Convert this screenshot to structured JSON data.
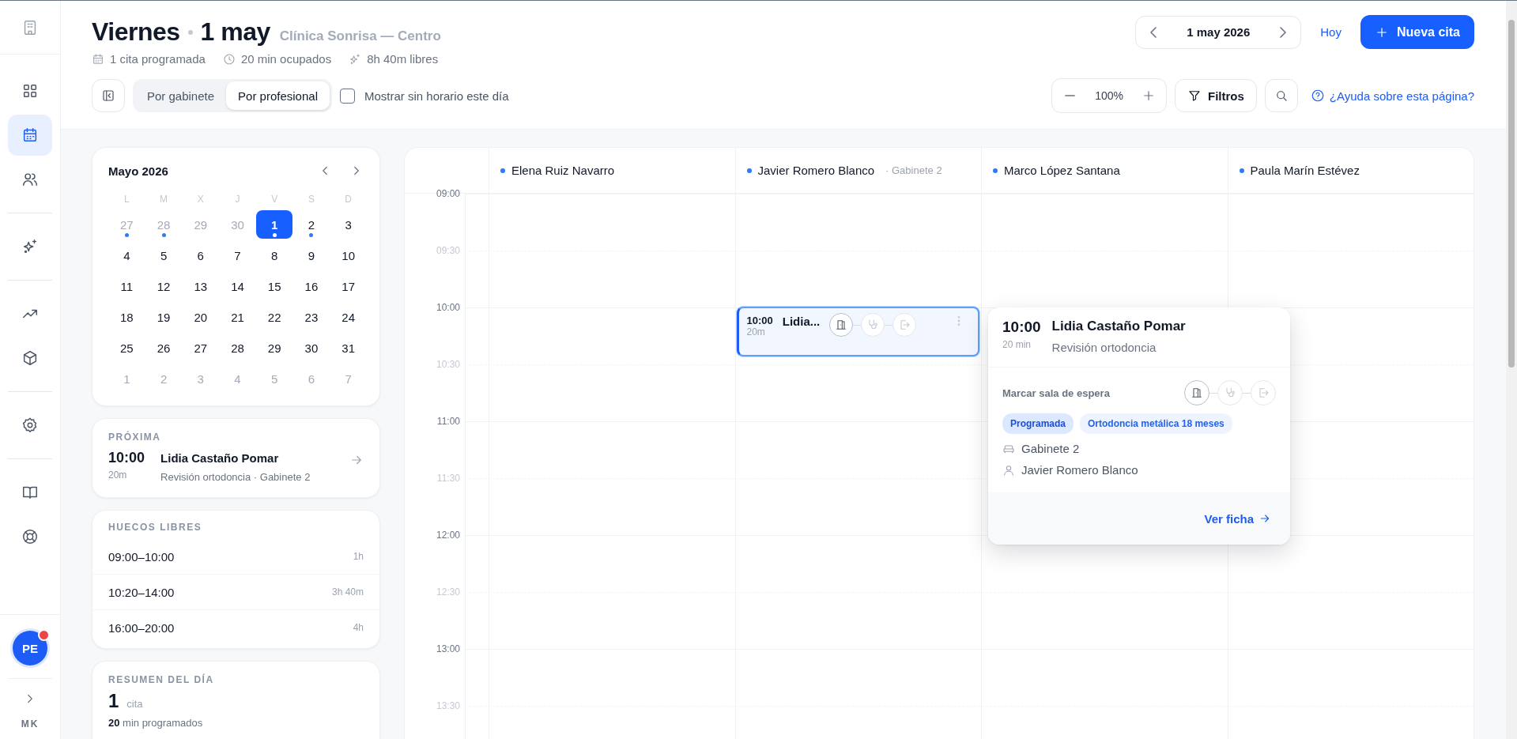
{
  "rail": {
    "top": {
      "selected": false
    },
    "groups": [
      [
        {
          "selected": false
        },
        {
          "selected": true
        },
        {
          "selected": false
        }
      ],
      [
        {
          "selected": false
        }
      ],
      [
        {
          "selected": false
        },
        {
          "selected": false
        }
      ],
      [
        {
          "selected": false
        }
      ],
      [
        {
          "selected": false
        },
        {
          "selected": false
        }
      ]
    ],
    "avatar": {
      "initials": "PE",
      "notification": true
    },
    "user_code": "MK"
  },
  "header": {
    "day": "Viernes",
    "date": "1 may",
    "clinic": "Clínica Sonrisa — Centro",
    "stats": [
      "1 cita programada",
      "20 min ocupados",
      "8h 40m libres"
    ],
    "date_nav": "1 may 2026",
    "today": "Hoy",
    "new_button": "Nueva cita",
    "view_toggle": [
      {
        "label": "Por gabinete",
        "selected": false
      },
      {
        "label": "Por profesional",
        "selected": true
      }
    ],
    "show_unscheduled": {
      "label": "Mostrar sin horario este día",
      "checked": false
    },
    "zoom": "100%",
    "filters": "Filtros",
    "help": "¿Ayuda sobre esta página?"
  },
  "mini_calendar": {
    "title": "Mayo 2026",
    "weekdays": [
      "L",
      "M",
      "X",
      "J",
      "V",
      "S",
      "D"
    ],
    "days": [
      {
        "label": "27",
        "outside": true,
        "selected": false,
        "has_event": true
      },
      {
        "label": "28",
        "outside": true,
        "selected": false,
        "has_event": true
      },
      {
        "label": "29",
        "outside": true,
        "selected": false,
        "has_event": false
      },
      {
        "label": "30",
        "outside": true,
        "selected": false,
        "has_event": false
      },
      {
        "label": "1",
        "outside": false,
        "selected": true,
        "has_event": true
      },
      {
        "label": "2",
        "outside": false,
        "selected": false,
        "has_event": true
      },
      {
        "label": "3",
        "outside": false,
        "selected": false,
        "has_event": false
      },
      {
        "label": "4",
        "outside": false,
        "selected": false,
        "has_event": false
      },
      {
        "label": "5",
        "outside": false,
        "selected": false,
        "has_event": false
      },
      {
        "label": "6",
        "outside": false,
        "selected": false,
        "has_event": false
      },
      {
        "label": "7",
        "outside": false,
        "selected": false,
        "has_event": false
      },
      {
        "label": "8",
        "outside": false,
        "selected": false,
        "has_event": false
      },
      {
        "label": "9",
        "outside": false,
        "selected": false,
        "has_event": false
      },
      {
        "label": "10",
        "outside": false,
        "selected": false,
        "has_event": false
      },
      {
        "label": "11",
        "outside": false,
        "selected": false,
        "has_event": false
      },
      {
        "label": "12",
        "outside": false,
        "selected": false,
        "has_event": false
      },
      {
        "label": "13",
        "outside": false,
        "selected": false,
        "has_event": false
      },
      {
        "label": "14",
        "outside": false,
        "selected": false,
        "has_event": false
      },
      {
        "label": "15",
        "outside": false,
        "selected": false,
        "has_event": false
      },
      {
        "label": "16",
        "outside": false,
        "selected": false,
        "has_event": false
      },
      {
        "label": "17",
        "outside": false,
        "selected": false,
        "has_event": false
      },
      {
        "label": "18",
        "outside": false,
        "selected": false,
        "has_event": false
      },
      {
        "label": "19",
        "outside": false,
        "selected": false,
        "has_event": false
      },
      {
        "label": "20",
        "outside": false,
        "selected": false,
        "has_event": false
      },
      {
        "label": "21",
        "outside": false,
        "selected": false,
        "has_event": false
      },
      {
        "label": "22",
        "outside": false,
        "selected": false,
        "has_event": false
      },
      {
        "label": "23",
        "outside": false,
        "selected": false,
        "has_event": false
      },
      {
        "label": "24",
        "outside": false,
        "selected": false,
        "has_event": false
      },
      {
        "label": "25",
        "outside": false,
        "selected": false,
        "has_event": false
      },
      {
        "label": "26",
        "outside": false,
        "selected": false,
        "has_event": false
      },
      {
        "label": "27",
        "outside": false,
        "selected": false,
        "has_event": false
      },
      {
        "label": "28",
        "outside": false,
        "selected": false,
        "has_event": false
      },
      {
        "label": "29",
        "outside": false,
        "selected": false,
        "has_event": false
      },
      {
        "label": "30",
        "outside": false,
        "selected": false,
        "has_event": false
      },
      {
        "label": "31",
        "outside": false,
        "selected": false,
        "has_event": false
      },
      {
        "label": "1",
        "outside": true,
        "selected": false,
        "has_event": false
      },
      {
        "label": "2",
        "outside": true,
        "selected": false,
        "has_event": false
      },
      {
        "label": "3",
        "outside": true,
        "selected": false,
        "has_event": false
      },
      {
        "label": "4",
        "outside": true,
        "selected": false,
        "has_event": false
      },
      {
        "label": "5",
        "outside": true,
        "selected": false,
        "has_event": false
      },
      {
        "label": "6",
        "outside": true,
        "selected": false,
        "has_event": false
      },
      {
        "label": "7",
        "outside": true,
        "selected": false,
        "has_event": false
      }
    ]
  },
  "next": {
    "heading": "PRÓXIMA",
    "time": "10:00",
    "duration": "20m",
    "name": "Lidia Castaño Pomar",
    "detail": "Revisión ortodoncia · Gabinete 2"
  },
  "free_slots": {
    "heading": "HUECOS LIBRES",
    "rows": [
      {
        "range": "09:00–10:00",
        "length": "1h"
      },
      {
        "range": "10:20–14:00",
        "length": "3h 40m"
      },
      {
        "range": "16:00–20:00",
        "length": "4h"
      }
    ]
  },
  "summary": {
    "heading": "RESUMEN DEL DÍA",
    "count": "1",
    "unit": "cita",
    "note": "**20** min programados"
  },
  "schedule": {
    "times": [
      {
        "label": "09:00",
        "kind": "hour"
      },
      {
        "label": "09:30",
        "kind": "half"
      },
      {
        "label": "10:00",
        "kind": "hour"
      },
      {
        "label": "10:30",
        "kind": "half"
      },
      {
        "label": "11:00",
        "kind": "hour"
      },
      {
        "label": "11:30",
        "kind": "half"
      },
      {
        "label": "12:00",
        "kind": "hour"
      },
      {
        "label": "12:30",
        "kind": "half"
      },
      {
        "label": "13:00",
        "kind": "hour"
      },
      {
        "label": "13:30",
        "kind": "half"
      }
    ],
    "columns": [
      {
        "name": "Elena Ruiz Navarro"
      },
      {
        "name": "Javier Romero Blanco",
        "note": "· Gabinete 2",
        "events": [
          {
            "time": "10:00",
            "duration": "20m",
            "name": "Lidia...",
            "selected": true,
            "steps": [
              {
                "active": true
              },
              {
                "active": false
              },
              {
                "active": false
              }
            ]
          }
        ]
      },
      {
        "name": "Marco López Santana"
      },
      {
        "name": "Paula Marín Estévez"
      }
    ],
    "popover": {
      "time": "10:00",
      "duration": "20 min",
      "name": "Lidia Castaño Pomar",
      "service": "Revisión ortodoncia",
      "status_label": "Marcar sala de espera",
      "steps": [
        {
          "active": true
        },
        {
          "active": false
        },
        {
          "active": false
        }
      ],
      "tags": [
        {
          "label": "Programada",
          "kind": "status"
        },
        {
          "label": "Ortodoncia metálica 18 meses",
          "kind": "treatment"
        }
      ],
      "room": "Gabinete 2",
      "professional": "Javier Romero Blanco",
      "link": "Ver ficha"
    }
  }
}
